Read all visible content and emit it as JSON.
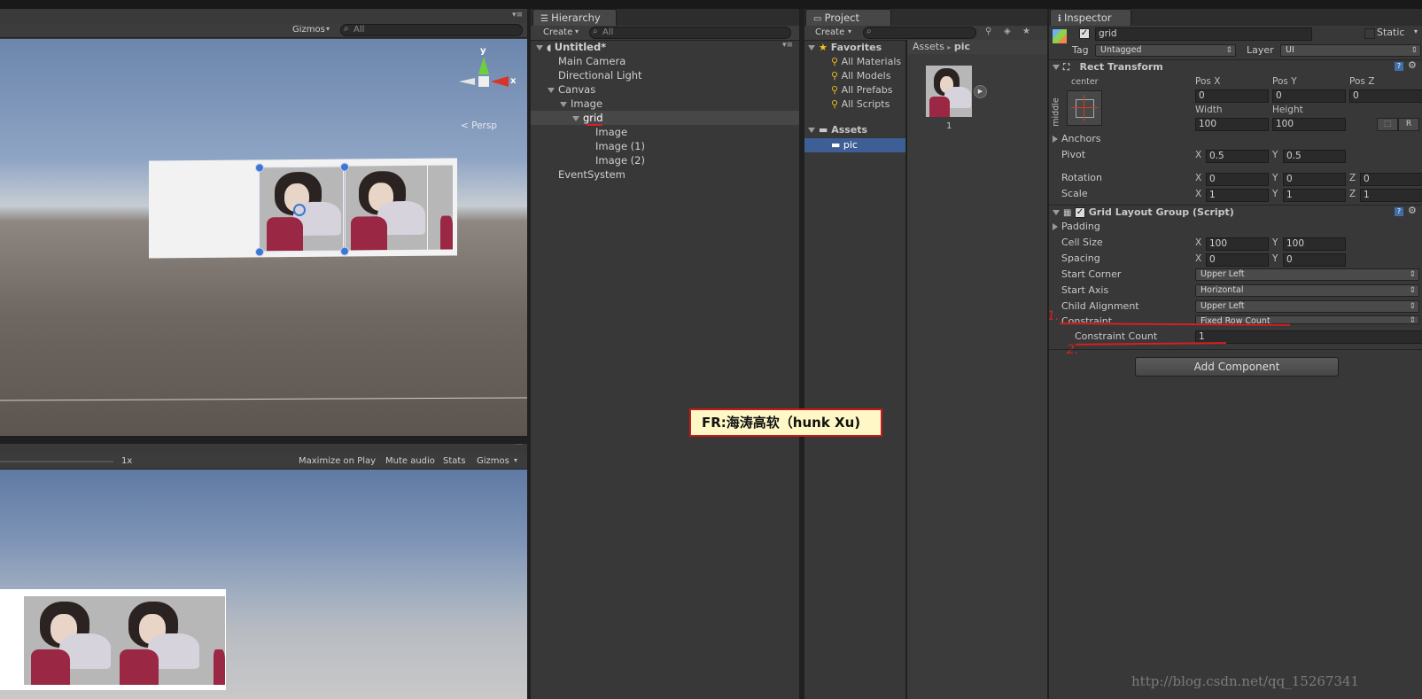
{
  "scene": {
    "gizmos": "Gizmos",
    "search_placeholder": "All",
    "persp": "< Persp",
    "axis_y": "y",
    "axis_x": "x"
  },
  "game": {
    "scale": "1x",
    "maximize": "Maximize on Play",
    "mute": "Mute audio",
    "stats": "Stats",
    "gizmos": "Gizmos"
  },
  "hierarchy": {
    "tab": "Hierarchy",
    "create": "Create",
    "search": "All",
    "scene_name": "Untitled*",
    "items": [
      {
        "label": "Main Camera"
      },
      {
        "label": "Directional Light"
      },
      {
        "label": "Canvas"
      },
      {
        "label": "Image"
      },
      {
        "label": "grid"
      },
      {
        "label": "Image"
      },
      {
        "label": "Image (1)"
      },
      {
        "label": "Image (2)"
      },
      {
        "label": "EventSystem"
      }
    ]
  },
  "project": {
    "tab": "Project",
    "create": "Create",
    "favorites": "Favorites",
    "fav_items": [
      "All Materials",
      "All Models",
      "All Prefabs",
      "All Scripts"
    ],
    "assets": "Assets",
    "pic_folder": "pic",
    "breadcrumb_assets": "Assets",
    "breadcrumb_sep": "▸",
    "breadcrumb_pic": "pic",
    "thumb_label": "1"
  },
  "watermark": "FR:海涛高软（hunk Xu)",
  "inspector": {
    "tab": "Inspector",
    "name": "grid",
    "static": "Static",
    "tag_label": "Tag",
    "tag_value": "Untagged",
    "layer_label": "Layer",
    "layer_value": "UI",
    "rect_transform": "Rect Transform",
    "anchor_top": "center",
    "anchor_side": "middle",
    "pos_x_label": "Pos X",
    "pos_y_label": "Pos Y",
    "pos_z_label": "Pos Z",
    "pos_x": "0",
    "pos_y": "0",
    "pos_z": "0",
    "width_label": "Width",
    "height_label": "Height",
    "width": "100",
    "height": "100",
    "r_btn": "R",
    "anchors": "Anchors",
    "pivot": "Pivot",
    "pivot_x": "0.5",
    "pivot_y": "0.5",
    "rotation": "Rotation",
    "rot_x": "0",
    "rot_y": "0",
    "rot_z": "0",
    "scale": "Scale",
    "scale_x": "1",
    "scale_y": "1",
    "scale_z": "1",
    "x": "X",
    "y": "Y",
    "z": "Z",
    "grid_layout": "Grid Layout Group (Script)",
    "padding": "Padding",
    "cell_size": "Cell Size",
    "cell_x": "100",
    "cell_y": "100",
    "spacing": "Spacing",
    "spacing_x": "0",
    "spacing_y": "0",
    "start_corner": "Start Corner",
    "start_corner_value": "Upper Left",
    "start_axis": "Start Axis",
    "start_axis_value": "Horizontal",
    "child_alignment": "Child Alignment",
    "child_alignment_value": "Upper Left",
    "constraint": "Constraint",
    "constraint_value": "Fixed Row Count",
    "constraint_count": "Constraint Count",
    "constraint_count_value": "1",
    "add_component": "Add Component",
    "annot_1": "1.",
    "annot_2": "2."
  },
  "footer_watermark": "http://blog.csdn.net/qq_15267341",
  "colors": {
    "selection": "#3e5f96",
    "annotation_red": "#d62020",
    "watermark_bg": "#fff8c6",
    "watermark_border": "#c41a1a"
  }
}
